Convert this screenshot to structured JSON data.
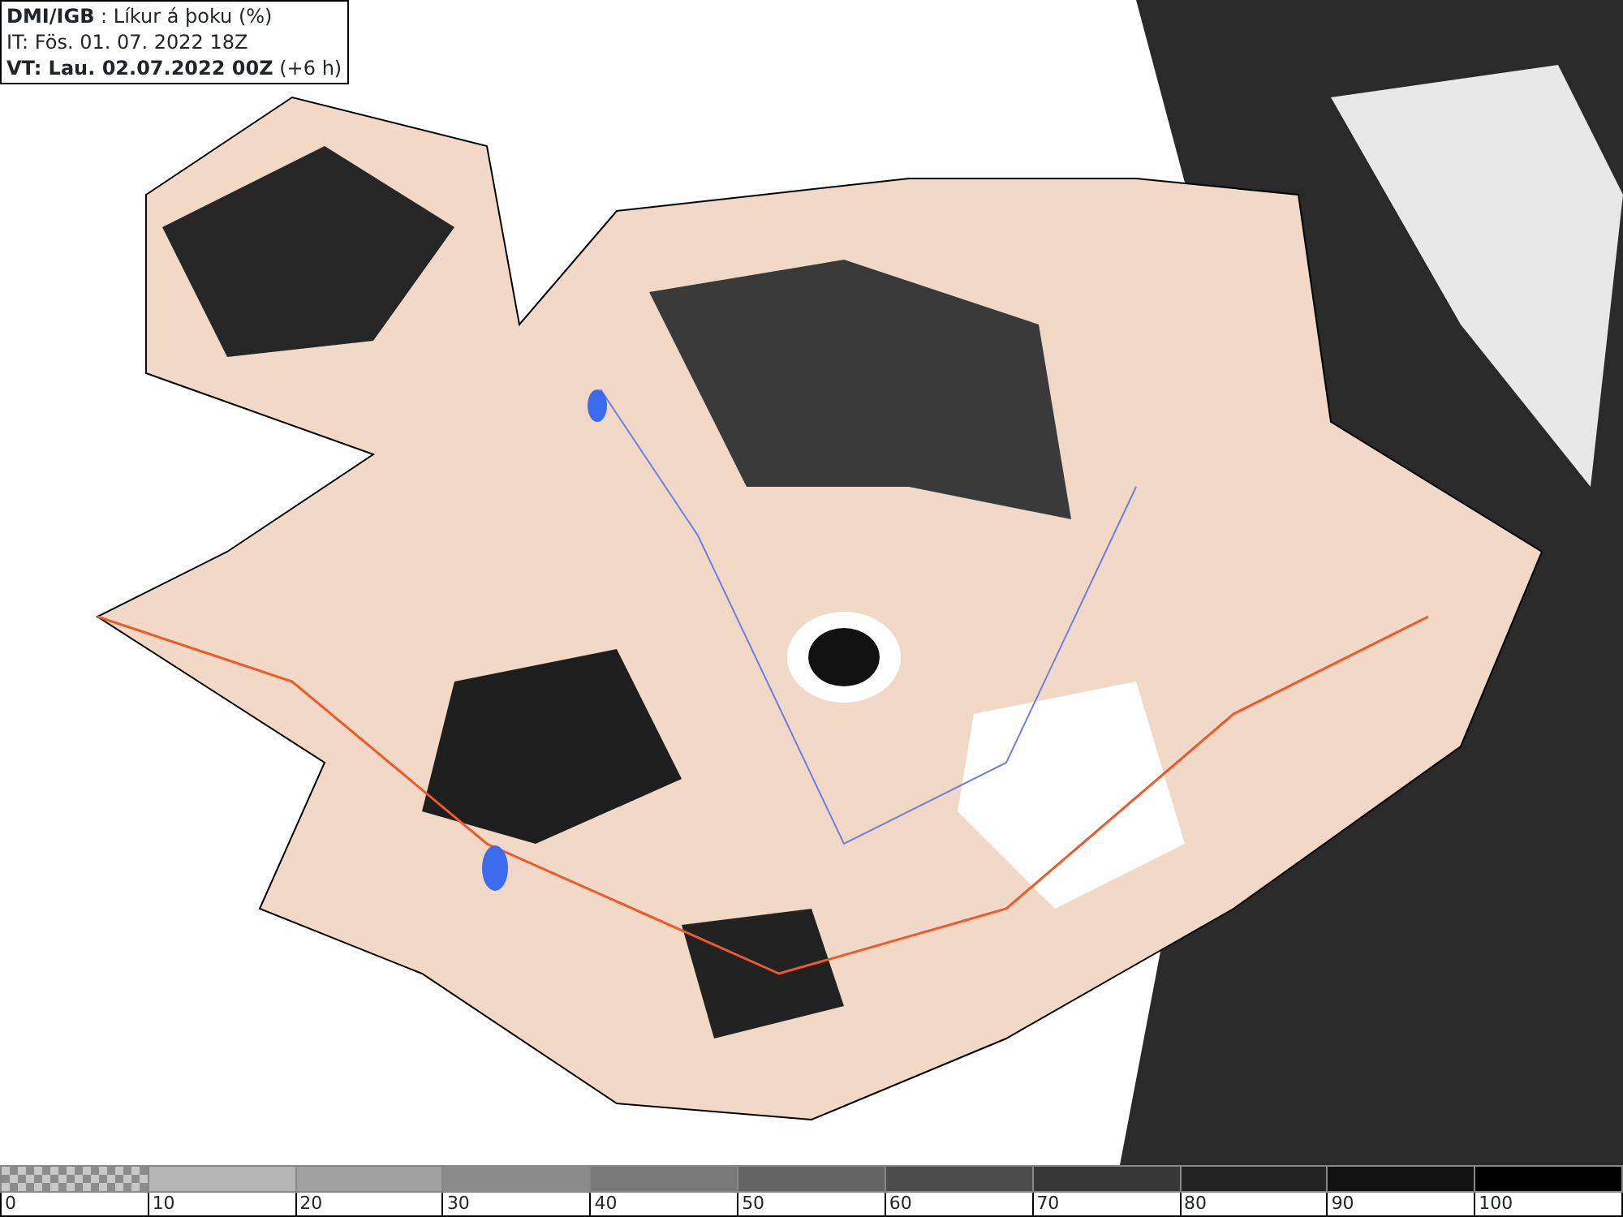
{
  "info_box": {
    "lines": [
      "**DMI/IGB** : Líkur á þoku (%)",
      "IT: Fös. 01. 07. 2022 18Z",
      "**VT: Lau. 02.07.2022 00Z** (+6 h)"
    ]
  },
  "legend": {
    "segments": [
      {
        "kind": "checker",
        "color": "#8c8c8c"
      },
      {
        "kind": "solid",
        "color": "#b4b4b4"
      },
      {
        "kind": "solid",
        "color": "#a0a0a0"
      },
      {
        "kind": "solid",
        "color": "#8c8c8c"
      },
      {
        "kind": "solid",
        "color": "#787878"
      },
      {
        "kind": "solid",
        "color": "#646464"
      },
      {
        "kind": "solid",
        "color": "#4b4b4b"
      },
      {
        "kind": "solid",
        "color": "#373737"
      },
      {
        "kind": "solid",
        "color": "#232323"
      },
      {
        "kind": "solid",
        "color": "#111111"
      },
      {
        "kind": "solid",
        "color": "#000000"
      }
    ],
    "ticks": [
      "0",
      "10",
      "20",
      "30",
      "40",
      "50",
      "60",
      "70",
      "80",
      "90",
      "100"
    ]
  }
}
